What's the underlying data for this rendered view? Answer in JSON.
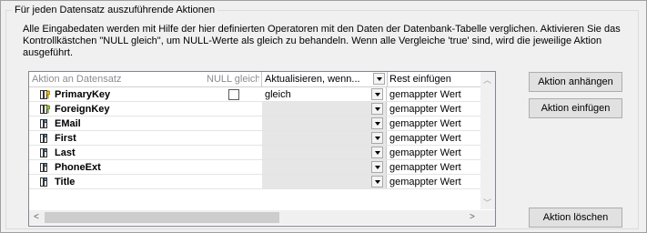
{
  "group": {
    "title": "Für jeden Datensatz auszuführende Aktionen",
    "description": "Alle Eingabedaten werden mit Hilfe der hier definierten Operatoren mit den Daten der Datenbank-Tabelle verglichen. Aktivieren Sie das Kontrollkästchen \"NULL gleich\", um NULL-Werte als gleich zu behandeln. Wenn alle Vergleiche 'true' sind, wird die jeweilige Aktion ausgeführt."
  },
  "table": {
    "headers": {
      "action": "Aktion an Datensatz",
      "null_equal": "NULL gleich",
      "update": "Aktualisieren, wenn...",
      "insert_rest": "Rest einfügen"
    },
    "rows": [
      {
        "field": "PrimaryKey",
        "icon": "primary-key-icon",
        "null_checkbox": true,
        "operator": "gleich",
        "rest": "gemappter Wert"
      },
      {
        "field": "ForeignKey",
        "icon": "foreign-key-icon",
        "null_checkbox": false,
        "operator": "",
        "rest": "gemappter Wert"
      },
      {
        "field": "EMail",
        "icon": "column-icon",
        "null_checkbox": false,
        "operator": "",
        "rest": "gemappter Wert"
      },
      {
        "field": "First",
        "icon": "column-icon",
        "null_checkbox": false,
        "operator": "",
        "rest": "gemappter Wert"
      },
      {
        "field": "Last",
        "icon": "column-icon",
        "null_checkbox": false,
        "operator": "",
        "rest": "gemappter Wert"
      },
      {
        "field": "PhoneExt",
        "icon": "column-icon",
        "null_checkbox": false,
        "operator": "",
        "rest": "gemappter Wert"
      },
      {
        "field": "Title",
        "icon": "column-icon",
        "null_checkbox": false,
        "operator": "",
        "rest": "gemappter Wert"
      }
    ]
  },
  "buttons": {
    "append": "Aktion anhängen",
    "insert": "Aktion einfügen",
    "delete": "Aktion löschen"
  }
}
